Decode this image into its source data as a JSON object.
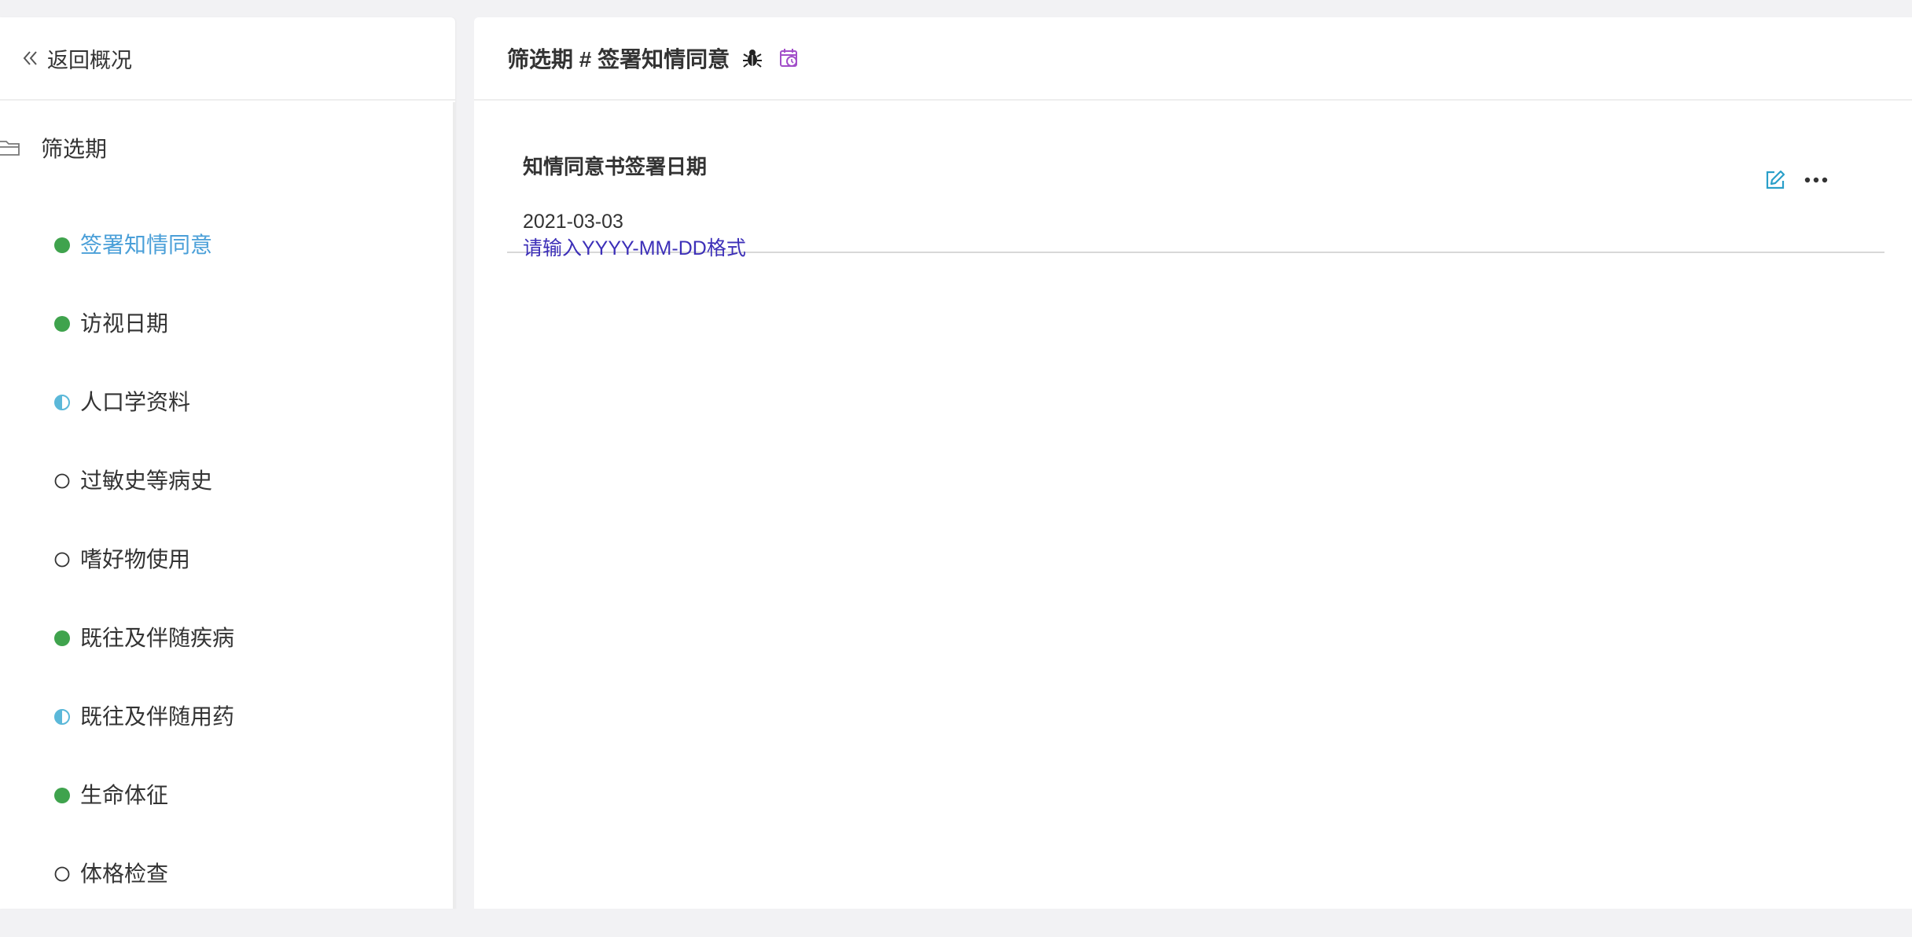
{
  "sidebar": {
    "back_label": "返回概况",
    "folder_label": "筛选期",
    "items": [
      {
        "label": "签署知情同意",
        "status": "complete",
        "active": true
      },
      {
        "label": "访视日期",
        "status": "complete",
        "active": false
      },
      {
        "label": "人口学资料",
        "status": "partial",
        "active": false
      },
      {
        "label": "过敏史等病史",
        "status": "empty",
        "active": false
      },
      {
        "label": "嗜好物使用",
        "status": "empty",
        "active": false
      },
      {
        "label": "既往及伴随疾病",
        "status": "complete",
        "active": false
      },
      {
        "label": "既往及伴随用药",
        "status": "partial",
        "active": false
      },
      {
        "label": "生命体征",
        "status": "complete",
        "active": false
      },
      {
        "label": "体格检查",
        "status": "empty",
        "active": false
      }
    ]
  },
  "main": {
    "title": "筛选期 # 签署知情同意",
    "field": {
      "label": "知情同意书签署日期",
      "value": "2021-03-03",
      "hint": "请输入YYYY-MM-DD格式"
    }
  },
  "colors": {
    "complete": "#3fa34d",
    "partial": "#5bb8d9",
    "active_text": "#4a9fd8",
    "hint_text": "#3c2fb8",
    "edit_icon": "#2a9fc9",
    "history_icon": "#a24ec9"
  },
  "icons": {
    "back": "double-chevron-left-icon",
    "folder": "folder-icon",
    "bug": "bug-icon",
    "history": "history-calendar-icon",
    "edit": "edit-icon",
    "more": "more-horizontal-icon"
  }
}
